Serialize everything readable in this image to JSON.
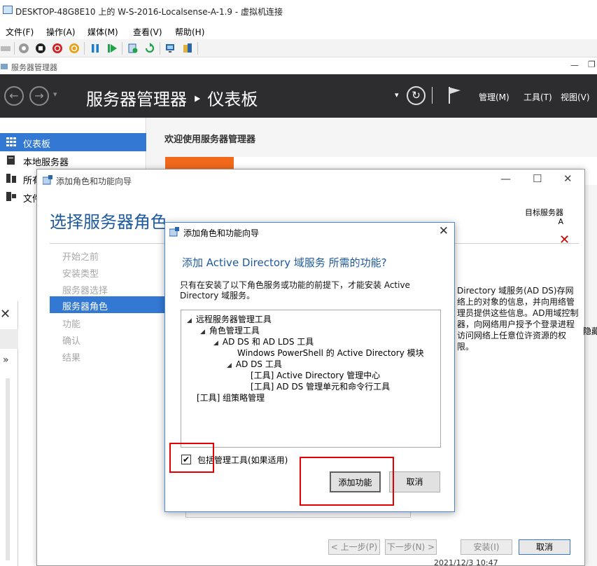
{
  "vm": {
    "title": "DESKTOP-48G8E10 上的 W-S-2016-Localsense-A-1.9 - 虚拟机连接",
    "menu": [
      "文件(F)",
      "操作(A)",
      "媒体(M)",
      "查看(V)",
      "帮助(H)"
    ]
  },
  "server_manager": {
    "window_title": "服务器管理器",
    "breadcrumb": "服务器管理器 ‣ 仪表板",
    "header_menu": [
      "管理(M)",
      "工具(T)",
      "视图(V)"
    ],
    "sidebar": [
      {
        "label": "仪表板",
        "active": true
      },
      {
        "label": "本地服务器"
      },
      {
        "label": "所有"
      },
      {
        "label": "文件"
      }
    ],
    "welcome": "欢迎使用服务器管理器",
    "timestamp": "2021/12/3 10:47"
  },
  "wizard": {
    "title": "添加角色和功能向导",
    "heading": "选择服务器角色",
    "target_label": "目标服务器",
    "target_value": "A",
    "steps": [
      {
        "label": "开始之前"
      },
      {
        "label": "安装类型"
      },
      {
        "label": "服务器选择"
      },
      {
        "label": "服务器角色",
        "active": true
      },
      {
        "label": "功能"
      },
      {
        "label": "确认"
      },
      {
        "label": "结果"
      }
    ],
    "description": "Directory 域服务(AD DS)存网络上的对象的信息，并向用络管理员提供这些信息。AD用域控制器，向网络用户授予个登录进程访问网络上任意位许资源的权限。",
    "hidden_text": "隐藏",
    "buttons": {
      "prev": "< 上一步(P)",
      "next": "下一步(N) >",
      "install": "安装(I)",
      "cancel": "取消"
    }
  },
  "modal": {
    "title": "添加角色和功能向导",
    "question": "添加 Active Directory 域服务 所需的功能?",
    "body": "只有在安装了以下角色服务或功能的前提下，才能安装 Active Directory 域服务。",
    "tree": [
      {
        "label": "远程服务器管理工具",
        "level": 0,
        "expanded": true
      },
      {
        "label": "角色管理工具",
        "level": 1,
        "expanded": true
      },
      {
        "label": "AD DS 和 AD LDS 工具",
        "level": 2,
        "expanded": true
      },
      {
        "label": "Windows PowerShell 的 Active Directory 模块",
        "level": 3
      },
      {
        "label": "AD DS 工具",
        "level": 3,
        "expanded": true
      },
      {
        "label": "[工具] Active Directory 管理中心",
        "level": 4
      },
      {
        "label": "[工具] AD DS 管理单元和命令行工具",
        "level": 4
      },
      {
        "label": "[工具] 组策略管理",
        "level": 0
      }
    ],
    "include_label": "包括管理工具(如果适用)",
    "include_checked": true,
    "add_button": "添加功能",
    "cancel_button": "取消"
  },
  "colors": {
    "accent": "#3379d4",
    "heading_blue": "#1e5aa0",
    "highlight_red": "#e30000",
    "tile_orange": "#f2691b",
    "header_dark": "#2d2d30"
  }
}
